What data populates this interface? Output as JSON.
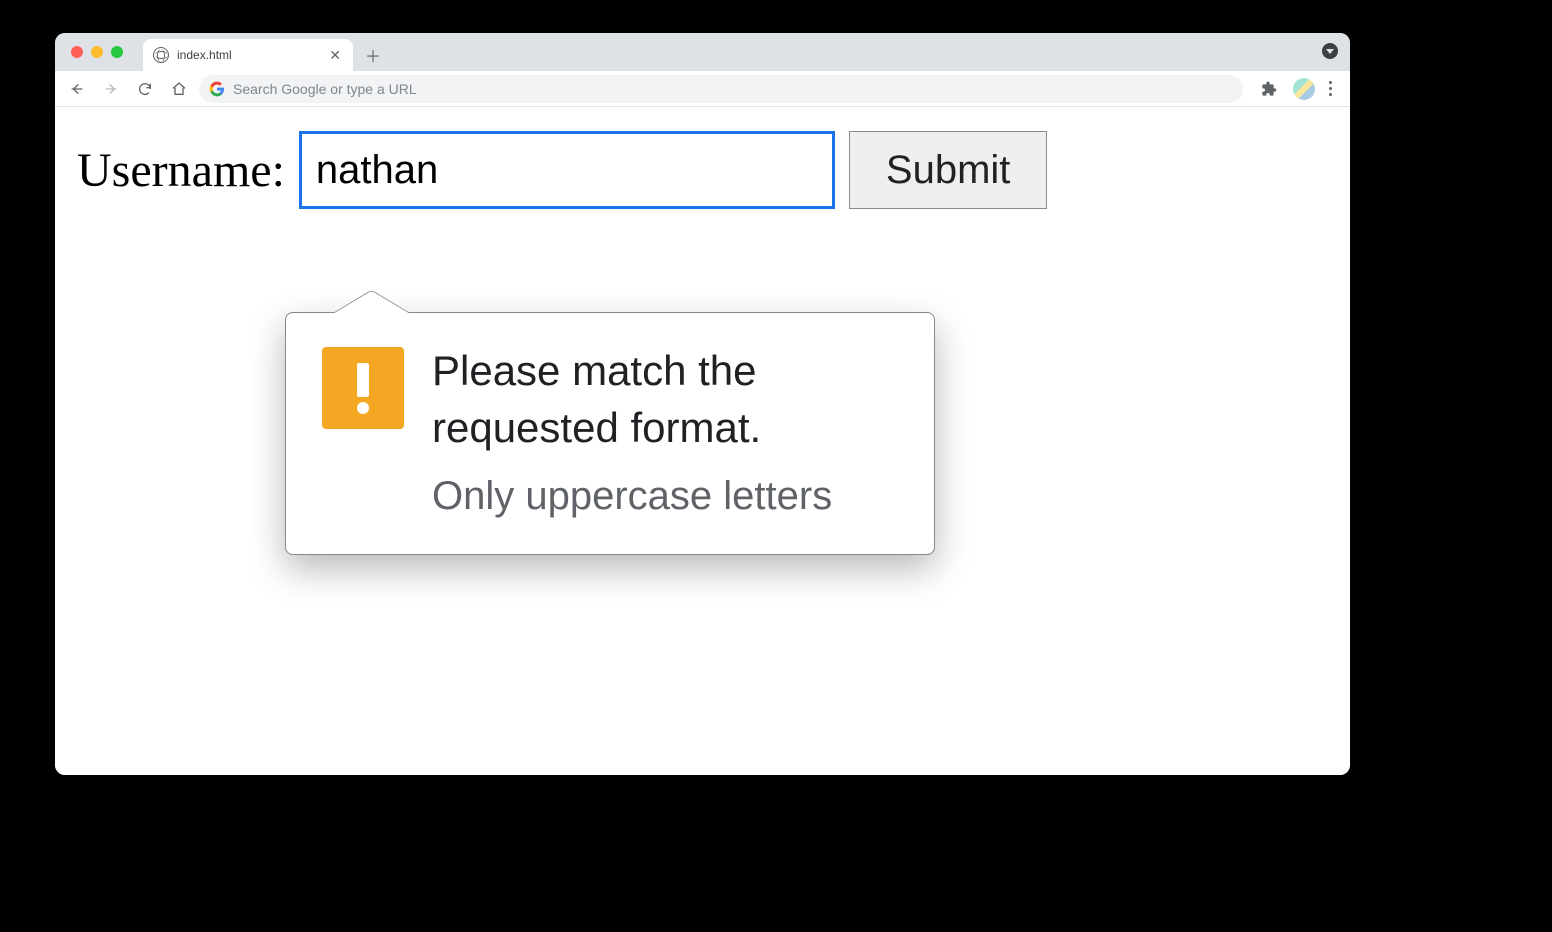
{
  "browser": {
    "tab_title": "index.html",
    "omnibox_placeholder": "Search Google or type a URL"
  },
  "form": {
    "label": "Username:",
    "input_value": "nathan",
    "submit_label": "Submit"
  },
  "validation": {
    "primary": "Please match the requested format.",
    "secondary": "Only uppercase letters"
  }
}
